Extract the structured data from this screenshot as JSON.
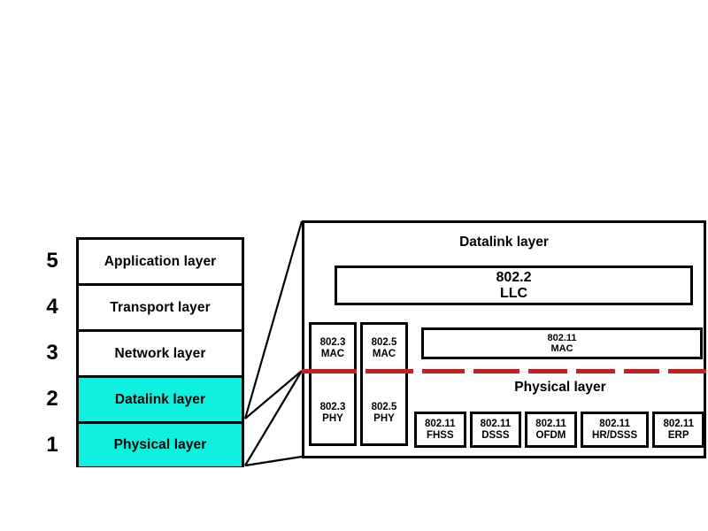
{
  "osi_stack": {
    "name": "OSI layer stack",
    "layers": [
      {
        "number": "5",
        "label": "Application layer",
        "highlighted": false
      },
      {
        "number": "4",
        "label": "Transport layer",
        "highlighted": false
      },
      {
        "number": "3",
        "label": "Network layer",
        "highlighted": false
      },
      {
        "number": "2",
        "label": "Datalink layer",
        "highlighted": true
      },
      {
        "number": "1",
        "label": "Physical layer",
        "highlighted": true
      }
    ],
    "highlight_color": "#0ff0e0",
    "border_color": "#000000"
  },
  "detail_panel": {
    "datalink_title": "Datalink layer",
    "physical_title": "Physical layer",
    "llc": {
      "line1": "802.2",
      "line2": "LLC"
    },
    "mac_80211": {
      "line1": "802.11",
      "line2": "MAC"
    },
    "columns": [
      {
        "mac": {
          "line1": "802.3",
          "line2": "MAC"
        },
        "phy": {
          "line1": "802.3",
          "line2": "PHY"
        }
      },
      {
        "mac": {
          "line1": "802.5",
          "line2": "MAC"
        },
        "phy": {
          "line1": "802.5",
          "line2": "PHY"
        }
      }
    ],
    "phy_variants": [
      {
        "line1": "802.11",
        "line2": "FHSS"
      },
      {
        "line1": "802.11",
        "line2": "DSSS"
      },
      {
        "line1": "802.11",
        "line2": "OFDM"
      },
      {
        "line1": "802.11",
        "line2": "HR/DSSS"
      },
      {
        "line1": "802.11",
        "line2": "ERP"
      }
    ],
    "divider_color": "#c42020"
  }
}
